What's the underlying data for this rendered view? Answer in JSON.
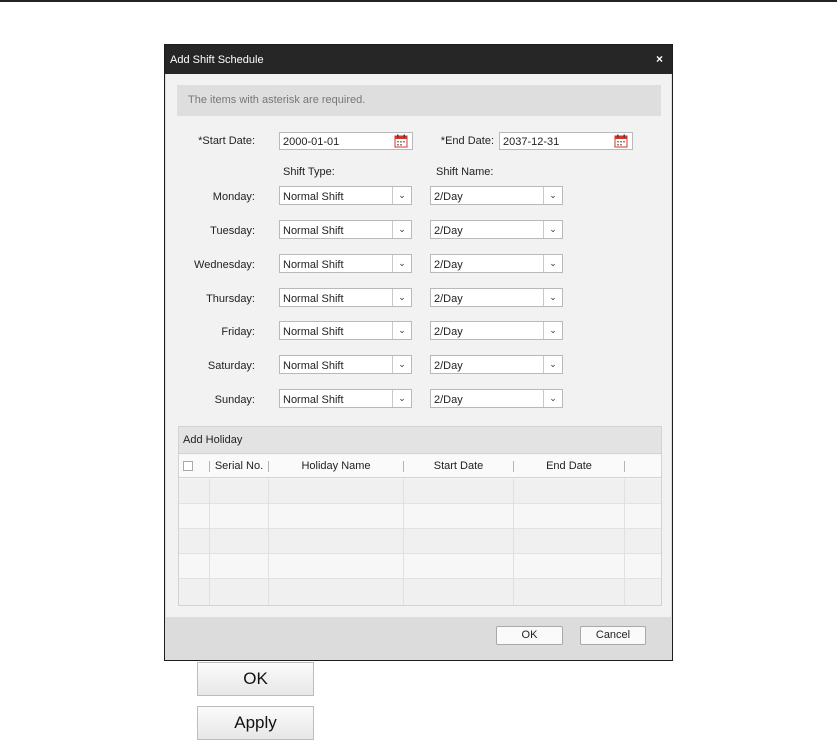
{
  "dialog": {
    "title": "Add Shift Schedule",
    "close_symbol": "×",
    "notice": "The items with asterisk are required.",
    "start_date_label": "*Start Date:",
    "start_date_value": "2000-01-01",
    "end_date_label": "*End Date:",
    "end_date_value": "2037-12-31",
    "shift_type_header": "Shift Type:",
    "shift_name_header": "Shift Name:",
    "days": [
      {
        "label": "Monday:",
        "shift_type": "Normal Shift",
        "shift_name": "2/Day"
      },
      {
        "label": "Tuesday:",
        "shift_type": "Normal Shift",
        "shift_name": "2/Day"
      },
      {
        "label": "Wednesday:",
        "shift_type": "Normal Shift",
        "shift_name": "2/Day"
      },
      {
        "label": "Thursday:",
        "shift_type": "Normal Shift",
        "shift_name": "2/Day"
      },
      {
        "label": "Friday:",
        "shift_type": "Normal Shift",
        "shift_name": "2/Day"
      },
      {
        "label": "Saturday:",
        "shift_type": "Normal Shift",
        "shift_name": "2/Day"
      },
      {
        "label": "Sunday:",
        "shift_type": "Normal Shift",
        "shift_name": "2/Day"
      }
    ],
    "holiday": {
      "title": "Add Holiday",
      "columns": [
        "Serial No.",
        "Holiday Name",
        "Start Date",
        "End Date"
      ]
    },
    "ok_label": "OK",
    "cancel_label": "Cancel"
  },
  "buttons": {
    "ok_large": "OK",
    "apply_large": "Apply"
  },
  "icons": {
    "calendar": "calendar-icon",
    "dropdown": "chevron-down-icon",
    "close": "close-icon"
  },
  "colors": {
    "titlebar": "#262626",
    "dialog_bg": "#dcdcdc",
    "content_bg": "#f2f2f2",
    "calendar_accent": "#d9342b"
  }
}
